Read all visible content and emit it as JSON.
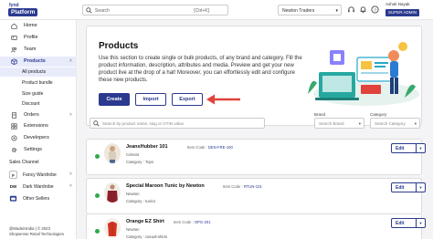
{
  "header": {
    "logo_top": "fynd",
    "logo_main": "Platform",
    "search_placeholder": "Search",
    "search_shortcut": "[Ctrl+K]",
    "store_selector": "Newton Traders",
    "user_name": "Ashok Nayak",
    "user_role": "SUPER ADMIN"
  },
  "sidebar": {
    "items": [
      {
        "label": "Home",
        "icon": "home-icon"
      },
      {
        "label": "Profile",
        "icon": "profile-icon"
      },
      {
        "label": "Team",
        "icon": "team-icon"
      },
      {
        "label": "Products",
        "icon": "products-icon"
      }
    ],
    "sub_items": [
      {
        "label": "All products"
      },
      {
        "label": "Product bundle"
      },
      {
        "label": "Size guide"
      },
      {
        "label": "Discount"
      }
    ],
    "items2": [
      {
        "label": "Orders",
        "icon": "orders-icon"
      },
      {
        "label": "Extensions",
        "icon": "extensions-icon"
      },
      {
        "label": "Developers",
        "icon": "developers-icon"
      },
      {
        "label": "Settings",
        "icon": "settings-icon"
      }
    ],
    "sales_channel_label": "Sales Channel",
    "channels": [
      {
        "label": "Fancy Wardrobe",
        "icon": "F"
      },
      {
        "label": "Dark Wardrobe",
        "icon": "DW"
      },
      {
        "label": "Other Sellers",
        "icon": ""
      }
    ],
    "footer_line1": "@Madeinindia | © 2023",
    "footer_line2": "Shopsense Retail Technologies"
  },
  "hero": {
    "title": "Products",
    "description": "Use this section to create single or bulk products, of any brand and category. Fill the product information, description, attributes and media. Preview and get your new product live at the drop of a hat! Moreover, you can effortlessly edit and configure these new products.",
    "create_label": "Create",
    "import_label": "Import",
    "export_label": "Export"
  },
  "filters": {
    "search_placeholder": "Search by product name, slug or GTIN value",
    "brand_label": "Brand",
    "brand_placeholder": "Search Brand",
    "category_label": "Category",
    "category_placeholder": "Search Category"
  },
  "products": [
    {
      "name": "JeansHubber 101",
      "code_label": "Item Code :",
      "code": "DEN-FRE-100",
      "brand": "Celerat",
      "category": "Category : Tops"
    },
    {
      "name": "Special Maroon Tunic by Newton",
      "code_label": "Item Code :",
      "code": "RTUN-101",
      "brand": "Newton",
      "category": "Category : tunics"
    },
    {
      "name": "Orange EZ Shirt",
      "code_label": "Item Code :",
      "code": "OPG-201",
      "brand": "Newton",
      "category": "Category : casual-shirts"
    }
  ],
  "edit_label": "Edit",
  "colors": {
    "primary": "#2b3a8f",
    "active_bg": "#e8ebfa",
    "status_green": "#2eaa4a",
    "arrow_red": "#e0433b"
  }
}
